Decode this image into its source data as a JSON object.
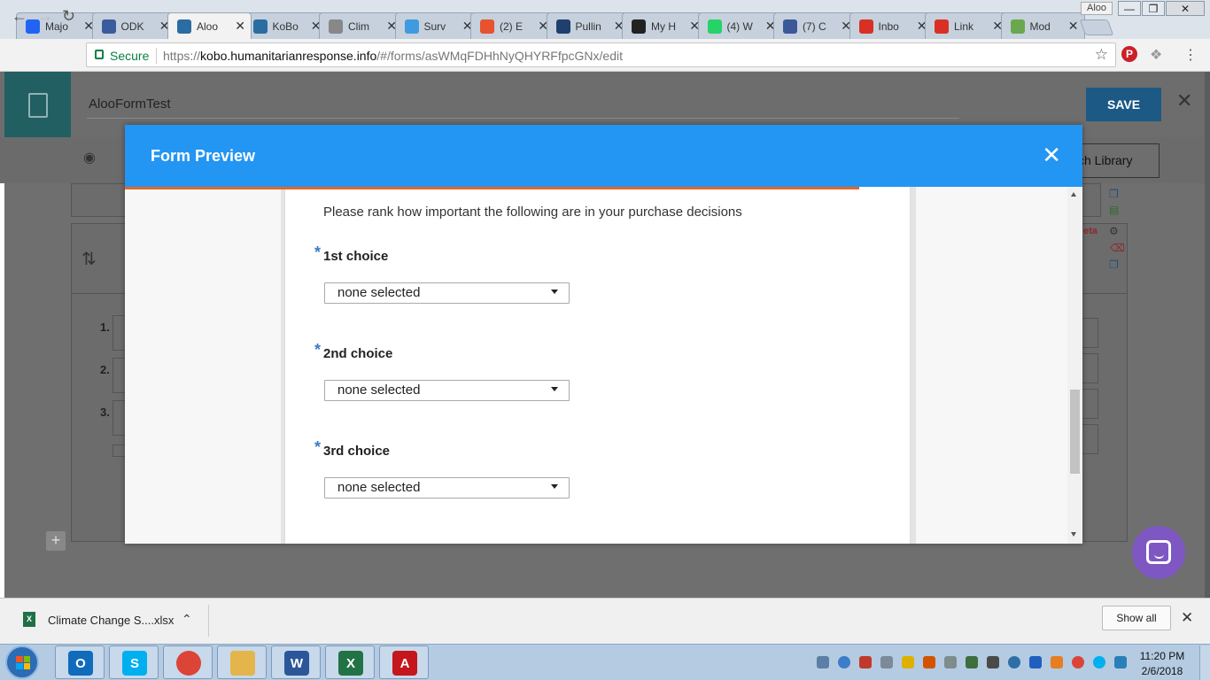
{
  "tabs": [
    {
      "title": "Majo",
      "icon": "indeed-icon",
      "color": "#2164f3"
    },
    {
      "title": "ODK",
      "icon": "odk-icon",
      "color": "#3a5c9c"
    },
    {
      "title": "Aloo",
      "icon": "kobo-icon",
      "color": "#2b6ca3",
      "active": true
    },
    {
      "title": "KoBo",
      "icon": "kobo-icon",
      "color": "#2b6ca3"
    },
    {
      "title": "Clim",
      "icon": "document-icon",
      "color": "#888888"
    },
    {
      "title": "Surv",
      "icon": "check-icon",
      "color": "#3e9be0"
    },
    {
      "title": "(2) E",
      "icon": "feed-icon",
      "color": "#e8522f"
    },
    {
      "title": "Pullin",
      "icon": "kobo-icon",
      "color": "#1f3f6e"
    },
    {
      "title": "My H",
      "icon": "stopwatch-icon",
      "color": "#222222"
    },
    {
      "title": "(4) W",
      "icon": "whatsapp-icon",
      "color": "#25d366"
    },
    {
      "title": "(7) C",
      "icon": "facebook-icon",
      "color": "#3b5998"
    },
    {
      "title": "Inbo",
      "icon": "gmail-icon",
      "color": "#d93025"
    },
    {
      "title": "Link",
      "icon": "gmail-icon",
      "color": "#d93025"
    },
    {
      "title": "Mod",
      "icon": "module-icon",
      "color": "#6aa84f"
    }
  ],
  "window": {
    "profile_name": "Aloo"
  },
  "address_bar": {
    "secure_label": "Secure",
    "url_scheme": "https://",
    "url_host": "kobo.humanitarianresponse.info",
    "url_path": "/#/forms/asWMqFDHhNyQHYRFfpcGNx/edit"
  },
  "app": {
    "form_title": "AlooFormTest",
    "save_label": "SAVE",
    "library_label": "ch Library",
    "question_numbers": [
      "1.",
      "2.",
      "3."
    ],
    "sidebar_meta_label": "eta"
  },
  "modal": {
    "title": "Form Preview",
    "prompt": "Please rank how important the following are in your purchase decisions",
    "required_marker": "*",
    "questions": [
      {
        "label": "1st choice",
        "value": "none selected"
      },
      {
        "label": "2nd choice",
        "value": "none selected"
      },
      {
        "label": "3rd choice",
        "value": "none selected"
      }
    ]
  },
  "download_bar": {
    "file_name": "Climate Change S....xlsx",
    "file_badge": "X",
    "show_all_label": "Show all"
  },
  "taskbar": {
    "apps": [
      {
        "name": "outlook",
        "glyph": "O",
        "color": "#0f6cbd"
      },
      {
        "name": "skype",
        "glyph": "S",
        "color": "#00aff0"
      },
      {
        "name": "chrome",
        "glyph": "",
        "color": "#db4437"
      },
      {
        "name": "file-explorer",
        "glyph": "",
        "color": "#e4b54a"
      },
      {
        "name": "word",
        "glyph": "W",
        "color": "#2b579a"
      },
      {
        "name": "excel",
        "glyph": "X",
        "color": "#217346"
      },
      {
        "name": "acrobat",
        "glyph": "A",
        "color": "#c4161c"
      }
    ],
    "time": "11:20 PM",
    "date": "2/6/2018"
  },
  "colors": {
    "modal_header": "#2395f2",
    "accent_bar": "#e3672a",
    "save_button": "#1c5985",
    "chat_bubble": "#7e57c2"
  }
}
